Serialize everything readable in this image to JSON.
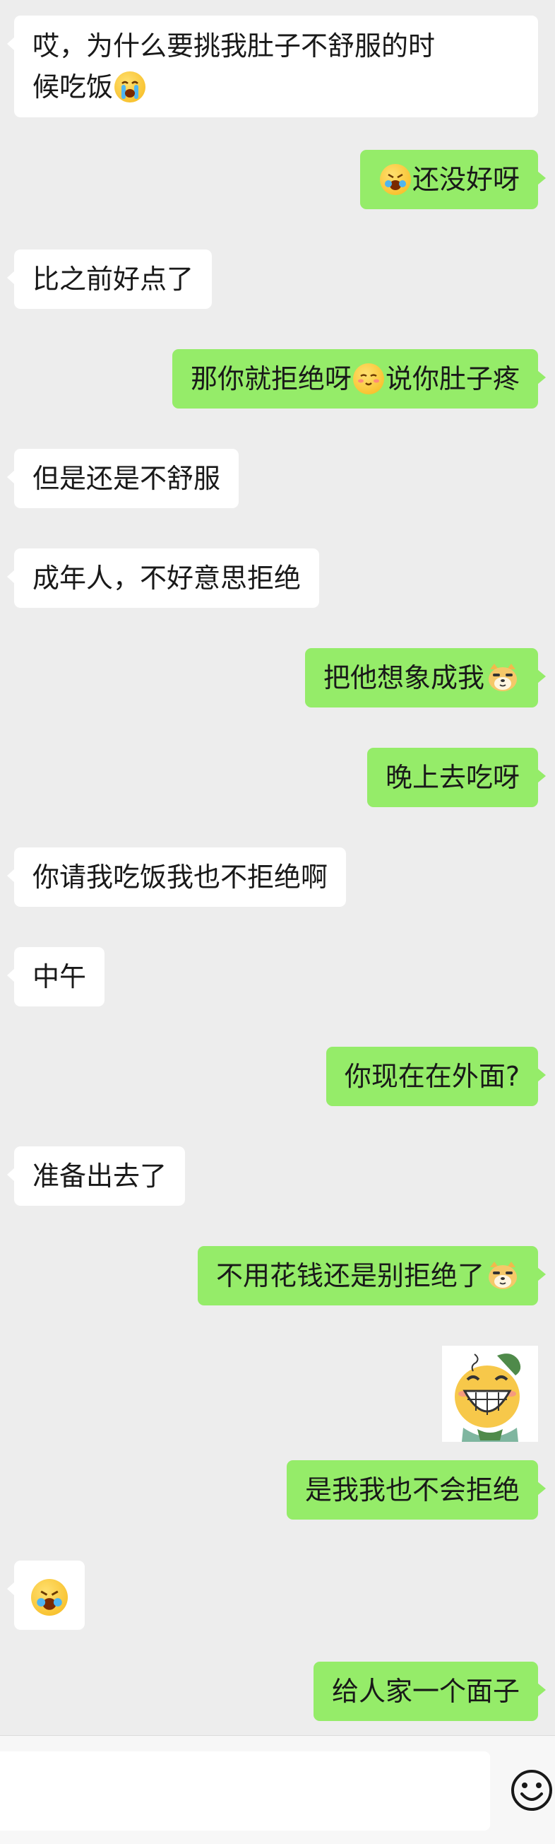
{
  "messages": [
    {
      "side": "left",
      "text_parts": [
        "哎，为什么要挑我肚子不舒服的时",
        "候吃饭"
      ],
      "emoji": "crying-face-icon"
    },
    {
      "side": "right",
      "emoji_before": "crying-face-icon",
      "text": "还没好呀"
    },
    {
      "side": "left",
      "text": "比之前好点了"
    },
    {
      "side": "right",
      "text_before": "那你就拒绝呀",
      "emoji": "smiling-face-icon",
      "text_after": "说你肚子疼"
    },
    {
      "side": "left",
      "text": "但是还是不舒服"
    },
    {
      "side": "left",
      "text": "成年人，不好意思拒绝"
    },
    {
      "side": "right",
      "text": "把他想象成我",
      "emoji": "doge-icon"
    },
    {
      "side": "right",
      "text": "晚上去吃呀"
    },
    {
      "side": "left",
      "text": "你请我吃饭我也不拒绝啊"
    },
    {
      "side": "left",
      "text": "中午"
    },
    {
      "side": "right",
      "text": "你现在在外面?"
    },
    {
      "side": "left",
      "text": "准备出去了"
    },
    {
      "side": "right",
      "text": "不用花钱还是别拒绝了",
      "emoji": "doge-icon"
    },
    {
      "side": "right",
      "sticker": "grinning-sticker"
    },
    {
      "side": "right",
      "text": "是我我也不会拒绝"
    },
    {
      "side": "left",
      "emoji": "crying-face-icon"
    },
    {
      "side": "right",
      "text": "给人家一个面子"
    }
  ],
  "m1": {
    "line1": "哎，为什么要挑我肚子不舒服的时",
    "line2": "候吃饭"
  },
  "m2": {
    "text": "还没好呀"
  },
  "m3": {
    "text": "比之前好点了"
  },
  "m4": {
    "before": "那你就拒绝呀",
    "after": "说你肚子疼"
  },
  "m5": {
    "text": "但是还是不舒服"
  },
  "m6": {
    "text": "成年人，不好意思拒绝"
  },
  "m7": {
    "text": "把他想象成我"
  },
  "m8": {
    "text": "晚上去吃呀"
  },
  "m9": {
    "text": "你请我吃饭我也不拒绝啊"
  },
  "m10": {
    "text": "中午"
  },
  "m11": {
    "text": "你现在在外面?"
  },
  "m12": {
    "text": "准备出去了"
  },
  "m13": {
    "text": "不用花钱还是别拒绝了"
  },
  "m15": {
    "text": "是我我也不会拒绝"
  },
  "m17": {
    "text": "给人家一个面子"
  },
  "input": {
    "value": "",
    "emoji_button_icon": "smiley-icon"
  },
  "colors": {
    "background": "#ededed",
    "incoming_bubble": "#ffffff",
    "outgoing_bubble": "#95ec69",
    "text": "#191919"
  }
}
